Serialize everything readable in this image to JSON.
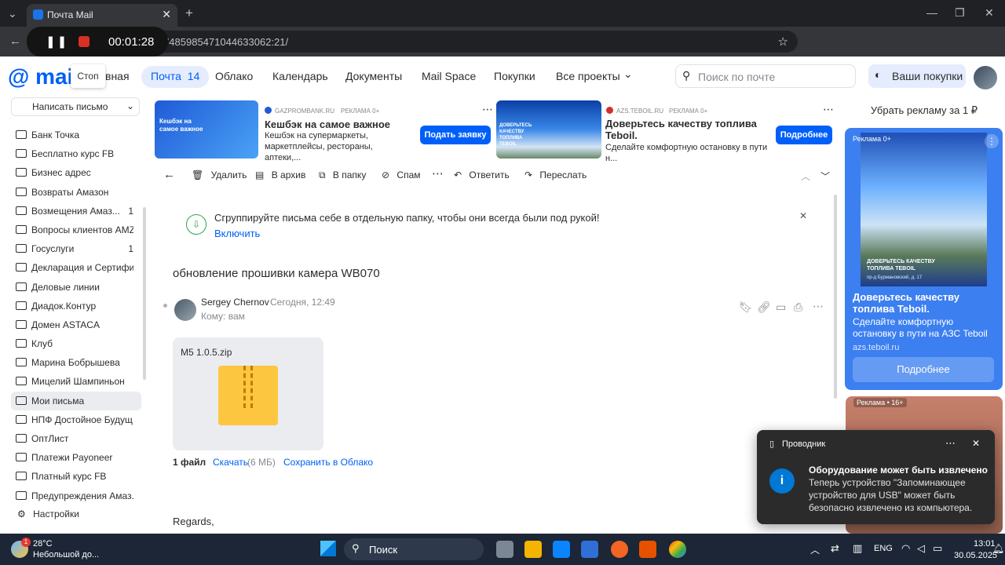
{
  "browser": {
    "tab_title": "Почта Mail",
    "url_fragment": "0:17485985471044633062:21/",
    "recorder_time": "00:01:28",
    "recorder_pause": "❚❚",
    "stop_tooltip": "Стоп"
  },
  "header": {
    "logo": "@ mail",
    "nav_partial": "вная",
    "mail_label": "Почта",
    "mail_count": "14",
    "nav": [
      "Облако",
      "Календарь",
      "Документы",
      "Mail Space",
      "Покупки",
      "Все проекты"
    ],
    "search_placeholder": "Поиск по почте",
    "purchases": "Ваши покупки"
  },
  "sidebar": {
    "compose": "Написать письмо",
    "folders": [
      {
        "name": "Банк Точка",
        "count": ""
      },
      {
        "name": "Бесплатно курс FB",
        "count": ""
      },
      {
        "name": "Бизнес адрес",
        "count": ""
      },
      {
        "name": "Возвраты Амазон",
        "count": ""
      },
      {
        "name": "Возмещения Амаз...",
        "count": "1"
      },
      {
        "name": "Вопросы клиентов AMZ",
        "count": ""
      },
      {
        "name": "Госуслуги",
        "count": "1"
      },
      {
        "name": "Декларация и Сертифи...",
        "count": ""
      },
      {
        "name": "Деловые линии",
        "count": ""
      },
      {
        "name": "Диадок.Контур",
        "count": ""
      },
      {
        "name": "Домен ASTACA",
        "count": ""
      },
      {
        "name": "Клуб",
        "count": ""
      },
      {
        "name": "Марина Бобрышева",
        "count": ""
      },
      {
        "name": "Мицелий Шампиньон",
        "count": ""
      },
      {
        "name": "Мои письма",
        "count": ""
      },
      {
        "name": "НПФ Достойное Будущ...",
        "count": ""
      },
      {
        "name": "ОптЛист",
        "count": ""
      },
      {
        "name": "Платежи Payoneer",
        "count": ""
      },
      {
        "name": "Платный курс FB",
        "count": ""
      },
      {
        "name": "Предупреждения Амаз...",
        "count": ""
      }
    ],
    "settings": "Настройки"
  },
  "ads": {
    "ad1": {
      "source": "GAZPROMBANK.RU",
      "label": "РЕКЛАМА 0+",
      "title": "Кешбэк на самое важное",
      "desc": "Кешбэк на супермаркеты, маркетплейсы, рестораны, аптеки,...",
      "button": "Подать заявку",
      "img_text": "Кешбэк на самое важное"
    },
    "ad2": {
      "source": "AZS.TEBOIL.RU",
      "label": "РЕКЛАМА 0+",
      "title": "Доверьтесь качеству топлива Teboil.",
      "desc": "Сделайте комфортную остановку в пути н...",
      "button": "Подробнее",
      "img_text": "ДОВЕРЬТЕСЬ КАЧЕСТВУ ТОПЛИВА TEBOIL"
    },
    "remove_ads": "Убрать рекламу за 1 ₽",
    "right": {
      "label": "Реклама 0+",
      "img_caption": "ДОВЕРЬТЕСЬ КАЧЕСТВУ ТОПЛИВА TEBOIL",
      "img_address": "пр-д Бурмановский, д. 17",
      "title": "Доверьтесь качеству топлива Teboil.",
      "desc": "Сделайте комфортную остановку в пути на АЗС Teboil",
      "domain": "azs.teboil.ru",
      "button": "Подробнее"
    },
    "right2_label": "Реклама • 16+"
  },
  "toolbar": {
    "delete": "Удалить",
    "archive": "В архив",
    "folder": "В папку",
    "spam": "Спам",
    "reply": "Ответить",
    "forward": "Переслать"
  },
  "letter": {
    "notice": "Сгруппируйте письма себе в отдельную папку, чтобы они всегда были под рукой!",
    "notice_action": "Включить",
    "subject": "обновление прошивки камера WB070",
    "sender": "Sergey Chernov",
    "time": "Сегодня, 12:49",
    "to": "Кому: вам",
    "attachment_name": "M5 1.0.5.zip",
    "files_count": "1 файл",
    "download": "Скачать",
    "size": "(6 МБ)",
    "save_cloud": "Сохранить в Облако",
    "body": "Regards,"
  },
  "toast": {
    "app": "Проводник",
    "title": "Оборудование может быть извлечено",
    "text": "Теперь устройство \"Запоминающее устройство для USB\" может быть безопасно извлечено из компьютера."
  },
  "taskbar": {
    "temp": "28°C",
    "weather": "Небольшой до...",
    "badge": "1",
    "search": "Поиск",
    "lang": "ENG",
    "time": "13:01",
    "date": "30.05.2025"
  }
}
